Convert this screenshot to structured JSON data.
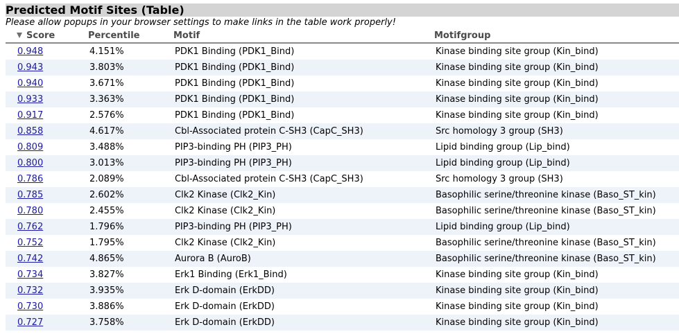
{
  "title": "Predicted Motif Sites (Table)",
  "notice": "Please allow popups in your browser settings to make links in the table work properly!",
  "columns": {
    "score": "Score",
    "percentile": "Percentile",
    "motif": "Motif",
    "motifgroup": "Motifgroup"
  },
  "sort": {
    "column": "Score",
    "direction": "descending",
    "icon": "sort-descending-icon"
  },
  "colors": {
    "title_bar": "#d4d4d4",
    "alt_row": "#eef2f9",
    "link": "#1a1aa6"
  },
  "rows": [
    {
      "score": "0.948",
      "percentile": "4.151%",
      "motif": "PDK1 Binding (PDK1_Bind)",
      "group": "Kinase binding site group (Kin_bind)"
    },
    {
      "score": "0.943",
      "percentile": "3.803%",
      "motif": "PDK1 Binding (PDK1_Bind)",
      "group": "Kinase binding site group (Kin_bind)"
    },
    {
      "score": "0.940",
      "percentile": "3.671%",
      "motif": "PDK1 Binding (PDK1_Bind)",
      "group": "Kinase binding site group (Kin_bind)"
    },
    {
      "score": "0.933",
      "percentile": "3.363%",
      "motif": "PDK1 Binding (PDK1_Bind)",
      "group": "Kinase binding site group (Kin_bind)"
    },
    {
      "score": "0.917",
      "percentile": "2.576%",
      "motif": "PDK1 Binding (PDK1_Bind)",
      "group": "Kinase binding site group (Kin_bind)"
    },
    {
      "score": "0.858",
      "percentile": "4.617%",
      "motif": "Cbl-Associated protein C-SH3 (CapC_SH3)",
      "group": "Src homology 3 group (SH3)"
    },
    {
      "score": "0.809",
      "percentile": "3.488%",
      "motif": "PIP3-binding PH (PIP3_PH)",
      "group": "Lipid binding group (Lip_bind)"
    },
    {
      "score": "0.800",
      "percentile": "3.013%",
      "motif": "PIP3-binding PH (PIP3_PH)",
      "group": "Lipid binding group (Lip_bind)"
    },
    {
      "score": "0.786",
      "percentile": "2.089%",
      "motif": "Cbl-Associated protein C-SH3 (CapC_SH3)",
      "group": "Src homology 3 group (SH3)"
    },
    {
      "score": "0.785",
      "percentile": "2.602%",
      "motif": "Clk2 Kinase (Clk2_Kin)",
      "group": "Basophilic serine/threonine kinase (Baso_ST_kin)"
    },
    {
      "score": "0.780",
      "percentile": "2.455%",
      "motif": "Clk2 Kinase (Clk2_Kin)",
      "group": "Basophilic serine/threonine kinase (Baso_ST_kin)"
    },
    {
      "score": "0.762",
      "percentile": "1.796%",
      "motif": "PIP3-binding PH (PIP3_PH)",
      "group": "Lipid binding group (Lip_bind)"
    },
    {
      "score": "0.752",
      "percentile": "1.795%",
      "motif": "Clk2 Kinase (Clk2_Kin)",
      "group": "Basophilic serine/threonine kinase (Baso_ST_kin)"
    },
    {
      "score": "0.742",
      "percentile": "4.865%",
      "motif": "Aurora B (AuroB)",
      "group": "Basophilic serine/threonine kinase (Baso_ST_kin)"
    },
    {
      "score": "0.734",
      "percentile": "3.827%",
      "motif": "Erk1 Binding (Erk1_Bind)",
      "group": "Kinase binding site group (Kin_bind)"
    },
    {
      "score": "0.732",
      "percentile": "3.935%",
      "motif": "Erk D-domain (ErkDD)",
      "group": "Kinase binding site group (Kin_bind)"
    },
    {
      "score": "0.730",
      "percentile": "3.886%",
      "motif": "Erk D-domain (ErkDD)",
      "group": "Kinase binding site group (Kin_bind)"
    },
    {
      "score": "0.727",
      "percentile": "3.758%",
      "motif": "Erk D-domain (ErkDD)",
      "group": "Kinase binding site group (Kin_bind)"
    }
  ]
}
